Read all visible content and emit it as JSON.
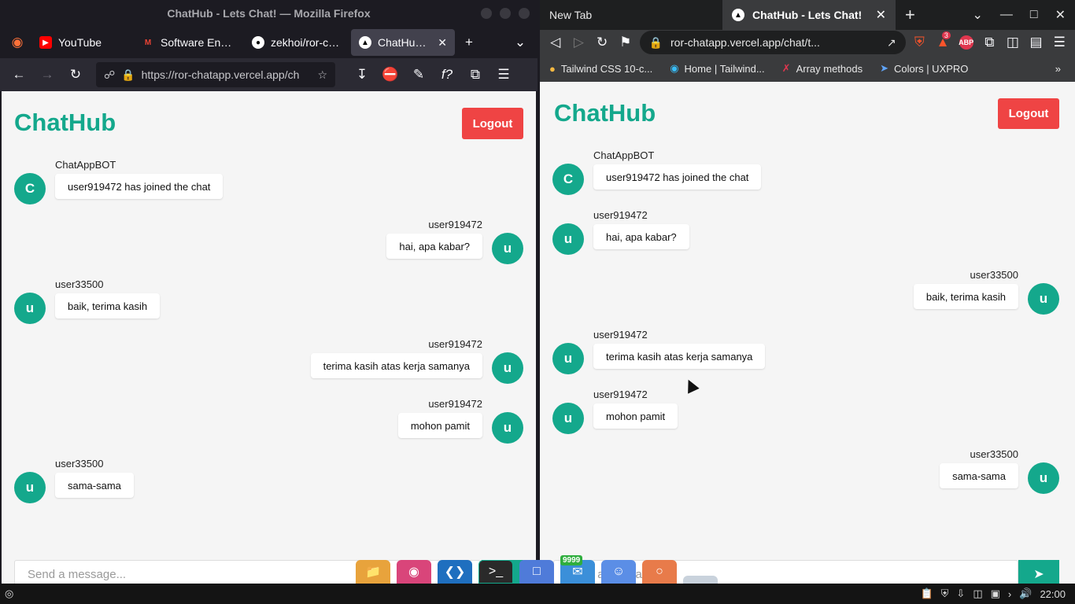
{
  "firefox": {
    "window_title": "ChatHub - Lets Chat! — Mozilla Firefox",
    "tabs": [
      {
        "label": "YouTube",
        "icon": "youtube-icon"
      },
      {
        "label": "Software Engine",
        "icon": "gmail-icon"
      },
      {
        "label": "zekhoi/ror-chat",
        "icon": "github-icon"
      },
      {
        "label": "ChatHub - Lets Chat!",
        "icon": "vercel-icon",
        "active": true
      }
    ],
    "url": "https://ror-chatapp.vercel.app/ch"
  },
  "brave": {
    "tabs": [
      {
        "label": "New Tab"
      },
      {
        "label": "ChatHub - Lets Chat!",
        "active": true
      }
    ],
    "url": "ror-chatapp.vercel.app/chat/t...",
    "shield_badge": "3",
    "bookmarks": [
      "Tailwind CSS 10-c...",
      "Home | Tailwind...",
      "Array methods",
      "Colors | UXPRO"
    ]
  },
  "app": {
    "brand": "ChatHub",
    "logout_label": "Logout",
    "send_placeholder": "Send a message...",
    "accent_color": "#14a88c",
    "logout_color": "#ef4444"
  },
  "left_messages": [
    {
      "user": "ChatAppBOT",
      "avatar": "C",
      "text": "user919472 has joined the chat",
      "side": "left"
    },
    {
      "user": "user919472",
      "avatar": "u",
      "text": "hai, apa kabar?",
      "side": "right"
    },
    {
      "user": "user33500",
      "avatar": "u",
      "text": "baik, terima kasih",
      "side": "left"
    },
    {
      "user": "user919472",
      "avatar": "u",
      "text": "terima kasih atas kerja samanya",
      "side": "right"
    },
    {
      "user": "user919472",
      "avatar": "u",
      "text": "mohon pamit",
      "side": "right"
    },
    {
      "user": "user33500",
      "avatar": "u",
      "text": "sama-sama",
      "side": "left"
    }
  ],
  "right_messages": [
    {
      "user": "ChatAppBOT",
      "avatar": "C",
      "text": "user919472 has joined the chat",
      "side": "left"
    },
    {
      "user": "user919472",
      "avatar": "u",
      "text": "hai, apa kabar?",
      "side": "left"
    },
    {
      "user": "user33500",
      "avatar": "u",
      "text": "baik, terima kasih",
      "side": "right"
    },
    {
      "user": "user919472",
      "avatar": "u",
      "text": "terima kasih atas kerja samanya",
      "side": "left"
    },
    {
      "user": "user919472",
      "avatar": "u",
      "text": "mohon pamit",
      "side": "left"
    },
    {
      "user": "user33500",
      "avatar": "u",
      "text": "sama-sama",
      "side": "right"
    }
  ],
  "taskbar": {
    "clock": "22:00",
    "dock_badge": "9999"
  }
}
